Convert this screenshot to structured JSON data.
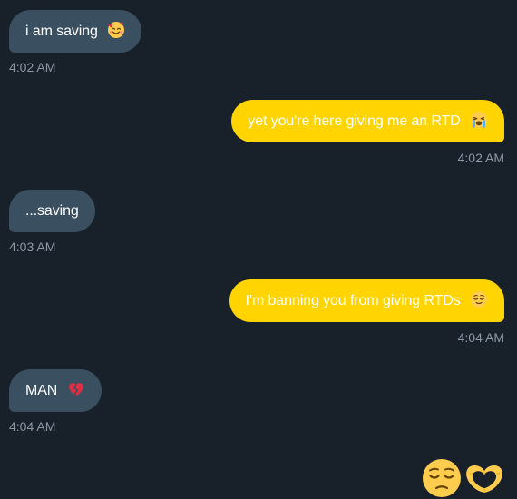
{
  "messages": [
    {
      "direction": "incoming",
      "text": "i am saving",
      "emoji": "smiling-face-with-hearts-icon",
      "time": "4:02 AM"
    },
    {
      "direction": "outgoing",
      "text": "yet you're here giving me an RTD",
      "emoji": "loudly-crying-face-icon",
      "time": "4:02 AM"
    },
    {
      "direction": "incoming",
      "text": "...saving",
      "emoji": "",
      "time": "4:03 AM"
    },
    {
      "direction": "outgoing",
      "text": "I'm banning you from giving RTDs",
      "emoji": "relieved-face-icon",
      "time": "4:04 AM"
    },
    {
      "direction": "incoming",
      "text": "MAN",
      "emoji": "broken-heart-icon",
      "time": "4:04 AM"
    }
  ],
  "footer_emojis": [
    "pensive-face-icon",
    "heart-hands-icon"
  ],
  "colors": {
    "background": "#18202a",
    "incoming_bubble": "#3a4f60",
    "outgoing_bubble": "#ffd400",
    "timestamp": "#8b98a5"
  }
}
